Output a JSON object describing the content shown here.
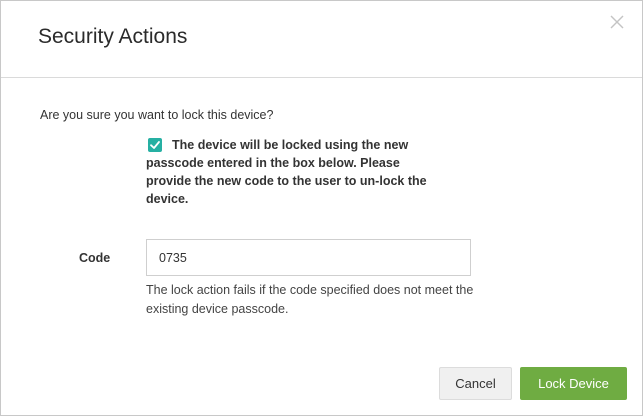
{
  "dialog": {
    "title": "Security Actions",
    "close_icon": "close-icon",
    "prompt": "Are you sure you want to lock this device?",
    "notice": {
      "checked": true,
      "text": "The device will be locked using the new passcode entered in the box below. Please provide the new code to the user to un-lock the device."
    },
    "code": {
      "label": "Code",
      "value": "0735",
      "hint": "The lock action fails if the code specified does not meet the existing device passcode."
    },
    "buttons": {
      "cancel": "Cancel",
      "lock": "Lock Device"
    }
  },
  "colors": {
    "checkbox": "#26b0a3",
    "primary_button": "#6fac42"
  }
}
